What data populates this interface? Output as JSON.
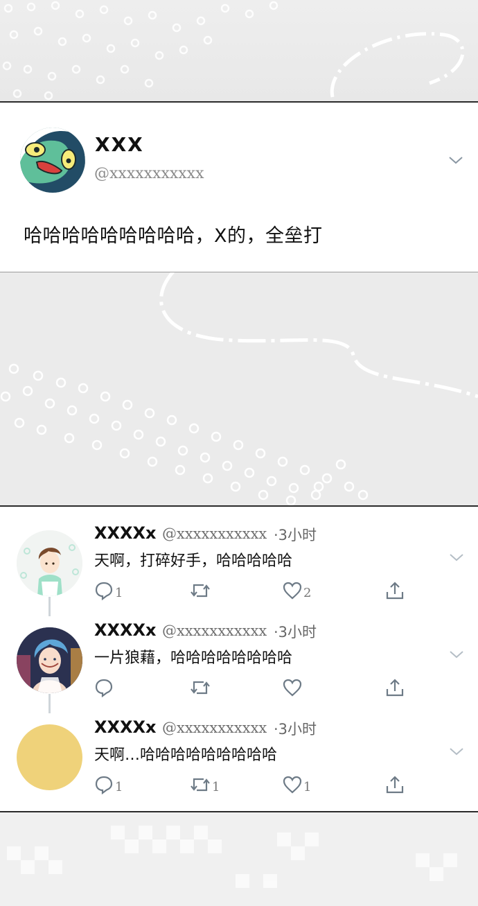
{
  "main_tweet": {
    "name": "XXX",
    "handle": "@xxxxxxxxxxx",
    "text": "哈哈哈哈哈哈哈哈哈，X的，全垒打"
  },
  "replies": [
    {
      "name": "XXXXx",
      "handle": "@xxxxxxxxxxx",
      "time": "·3小时",
      "text": "天啊，打碎好手，哈哈哈哈哈",
      "reply_count": "1",
      "retweet_count": "",
      "like_count": "2"
    },
    {
      "name": "XXXXx",
      "handle": "@xxxxxxxxxxx",
      "time": "·3小时",
      "text": "一片狼藉，哈哈哈哈哈哈哈哈",
      "reply_count": "",
      "retweet_count": "",
      "like_count": ""
    },
    {
      "name": "XXXXx",
      "handle": "@xxxxxxxxxxx",
      "time": "·3小时",
      "text": "天啊…哈哈哈哈哈哈哈哈哈",
      "reply_count": "1",
      "retweet_count": "1",
      "like_count": "1"
    }
  ],
  "icons": {
    "reply": "reply-icon",
    "retweet": "retweet-icon",
    "like": "heart-icon",
    "share": "share-icon",
    "menu": "chevron-down-icon"
  },
  "colors": {
    "panel_bg": "#ffffff",
    "background": "#ececec",
    "icon": "#8a97a3",
    "thread_line": "#cfd5da",
    "avatar_yellow": "#efd27a"
  }
}
